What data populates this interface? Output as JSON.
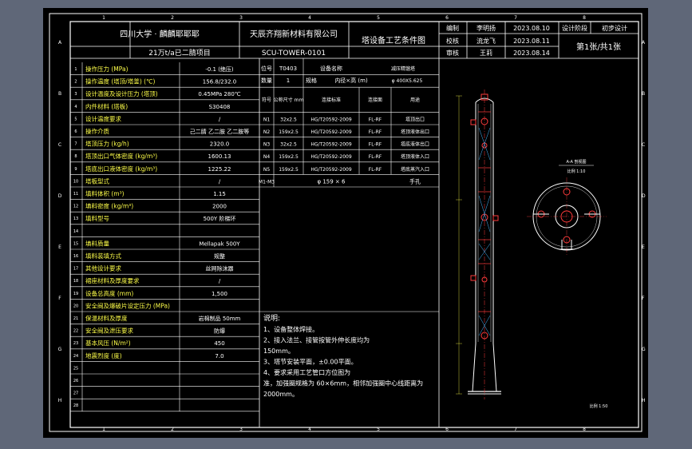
{
  "header": {
    "org1": "四川大学 · 麟麟耶耶耶",
    "org2": "天辰齐翔新材料有限公司",
    "project": "21万t/a已二腈项目",
    "drawing_no": "SCU-TOWER-0101",
    "drawing_title": "塔设备工艺条件图",
    "sign_rows": [
      {
        "role": "编制",
        "name": "李明扬",
        "date": "2023.08.10"
      },
      {
        "role": "校核",
        "name": "流龙飞",
        "date": "2023.08.11"
      },
      {
        "role": "审核",
        "name": "王莉",
        "date": "2023.08.14"
      }
    ],
    "stage": "设计阶段",
    "stage_value": "初步设计",
    "sheet_info": "第1张/共1张"
  },
  "params": {
    "rows": [
      {
        "no": "1",
        "label": "操作压力 (MPa)",
        "value": "-0.1 (绝压)"
      },
      {
        "no": "2",
        "label": "操作温度 (塔顶/塔釜) (℃)",
        "value": "156.8/232.0"
      },
      {
        "no": "3",
        "label": "设计温度及设计压力 (塔顶)",
        "value": "0.45MPa 280℃"
      },
      {
        "no": "4",
        "label": "内件材料 (塔板)",
        "value": "S30408"
      },
      {
        "no": "5",
        "label": "设计温度要求",
        "value": "/"
      },
      {
        "no": "6",
        "label": "操作介质",
        "value": "己二腈 乙二胺 乙二胺等"
      },
      {
        "no": "7",
        "label": "塔顶压力 (kg/h)",
        "value": "2320.0"
      },
      {
        "no": "8",
        "label": "塔顶出口气体密度 (kg/m³)",
        "value": "1600.13"
      },
      {
        "no": "9",
        "label": "塔底出口液体密度 (kg/m³)",
        "value": "1225.22"
      },
      {
        "no": "10",
        "label": "塔板型式",
        "value": "/"
      },
      {
        "no": "11",
        "label": "填料体积 (m³)",
        "value": "1.15"
      },
      {
        "no": "12",
        "label": "填料密度 (kg/m³)",
        "value": "2000"
      },
      {
        "no": "13",
        "label": "填料型号",
        "value": "500Y 阶梯环"
      },
      {
        "no": "14",
        "label": "",
        "value": ""
      },
      {
        "no": "15",
        "label": "填料质量",
        "value": "Mellapak 500Y"
      },
      {
        "no": "16",
        "label": "填料装填方式",
        "value": "规整"
      },
      {
        "no": "17",
        "label": "其他设计要求",
        "value": "丝网除沫器"
      },
      {
        "no": "18",
        "label": "裙座材料及厚度要求",
        "value": "/"
      },
      {
        "no": "19",
        "label": "设备总高度 (mm)",
        "value": "1,500"
      },
      {
        "no": "20",
        "label": "安全阀及爆破片设定压力 (MPa)",
        "value": ""
      },
      {
        "no": "21",
        "label": "保温材料及厚度",
        "value": "岩棉制品 50mm"
      },
      {
        "no": "22",
        "label": "安全阀及泄压要求",
        "value": "防爆"
      },
      {
        "no": "23",
        "label": "基本风压 (N/m²)",
        "value": "450"
      },
      {
        "no": "24",
        "label": "地震烈度 (度)",
        "value": "7.0"
      },
      {
        "no": "25",
        "label": "",
        "value": ""
      },
      {
        "no": "26",
        "label": "",
        "value": ""
      },
      {
        "no": "27",
        "label": "",
        "value": ""
      },
      {
        "no": "28",
        "label": "",
        "value": ""
      }
    ]
  },
  "equipment": {
    "h1": [
      "位号",
      "T0403",
      "设备名称",
      "减压精馏塔"
    ],
    "h2": [
      "数量",
      "1",
      "规格",
      "内径×高 (m)",
      "φ 400X5.625"
    ],
    "nozzle_headers": [
      "符号",
      "公称尺寸 mm",
      "连接标准",
      "连接面",
      "用途"
    ],
    "nozzles": [
      {
        "sym": "N1",
        "size": "32x2.5",
        "std": "HG/T20592-2009",
        "face": "FL-RF",
        "use": "塔顶出口"
      },
      {
        "sym": "N2",
        "size": "159x2.5",
        "std": "HG/T20592-2009",
        "face": "FL-RF",
        "use": "塔顶液体出口"
      },
      {
        "sym": "N3",
        "size": "32x2.5",
        "std": "HG/T20592-2009",
        "face": "FL-RF",
        "use": "塔底液体出口"
      },
      {
        "sym": "N4",
        "size": "159x2.5",
        "std": "HG/T20592-2009",
        "face": "FL-RF",
        "use": "塔顶液体入口"
      },
      {
        "sym": "N5",
        "size": "159x2.5",
        "std": "HG/T20592-2009",
        "face": "FL-RF",
        "use": "塔底蒸汽入口"
      }
    ],
    "manhole": {
      "sym": "M1-M3",
      "size": "φ 159 × 6",
      "use": "手孔"
    }
  },
  "notes": {
    "title": "说明:",
    "lines": [
      "1、设备整体焊接。",
      "2、接入法兰、接管按管外伸长度均为",
      "150mm。",
      "3、塔节安装平面，±0.00平面。",
      "4、要求采用工艺管口方位图为",
      "准，加强圈规格为 60×6mm，相邻加强圈中心线距离为",
      "2000mm。"
    ]
  },
  "drawing": {
    "section_label": "A-A 剖视图",
    "section_scale": "比例 1:10",
    "main_scale": "比例 1:50"
  },
  "frame": {
    "left_marks": [
      "A",
      "B",
      "C",
      "D",
      "E",
      "F",
      "G",
      "H"
    ],
    "top_marks": [
      "1",
      "2",
      "3",
      "4",
      "5",
      "6",
      "7",
      "8"
    ]
  }
}
